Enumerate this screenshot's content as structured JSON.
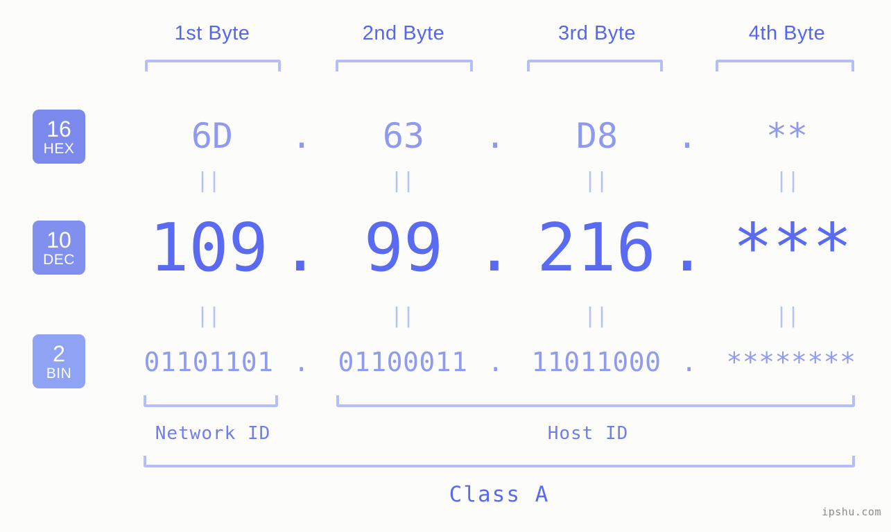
{
  "page": {
    "background_color": "#fcfdfa",
    "watermark": "ipshu.com"
  },
  "colors": {
    "accent_strong": "#5a6bf2",
    "accent_mid": "#8e99ef",
    "accent_light": "#b6bdf7",
    "badge_hex": "#7b88ec",
    "badge_dec": "#8190ef",
    "badge_bin": "#8fa3f5",
    "watermark_gray": "#8a8a8a"
  },
  "byte_headers": [
    {
      "label": "1st Byte"
    },
    {
      "label": "2nd Byte"
    },
    {
      "label": "3rd Byte"
    },
    {
      "label": "4th Byte"
    }
  ],
  "badges": [
    {
      "base": "16",
      "name": "HEX"
    },
    {
      "base": "10",
      "name": "DEC"
    },
    {
      "base": "2",
      "name": "BIN"
    }
  ],
  "separators": {
    "dot": "."
  },
  "equality_marks": {
    "symbol": "||",
    "count_per_row": 4
  },
  "rows": {
    "hex": {
      "radix": "16",
      "radix_name": "HEX",
      "values": [
        "6D",
        "63",
        "D8",
        "**"
      ]
    },
    "dec": {
      "radix": "10",
      "radix_name": "DEC",
      "values": [
        "109",
        "99",
        "216",
        "***"
      ]
    },
    "bin": {
      "radix": "2",
      "radix_name": "BIN",
      "values": [
        "01101101",
        "01100011",
        "11011000",
        "********"
      ]
    }
  },
  "id_labels": {
    "network": "Network ID",
    "host": "Host ID"
  },
  "class_label": "Class A"
}
